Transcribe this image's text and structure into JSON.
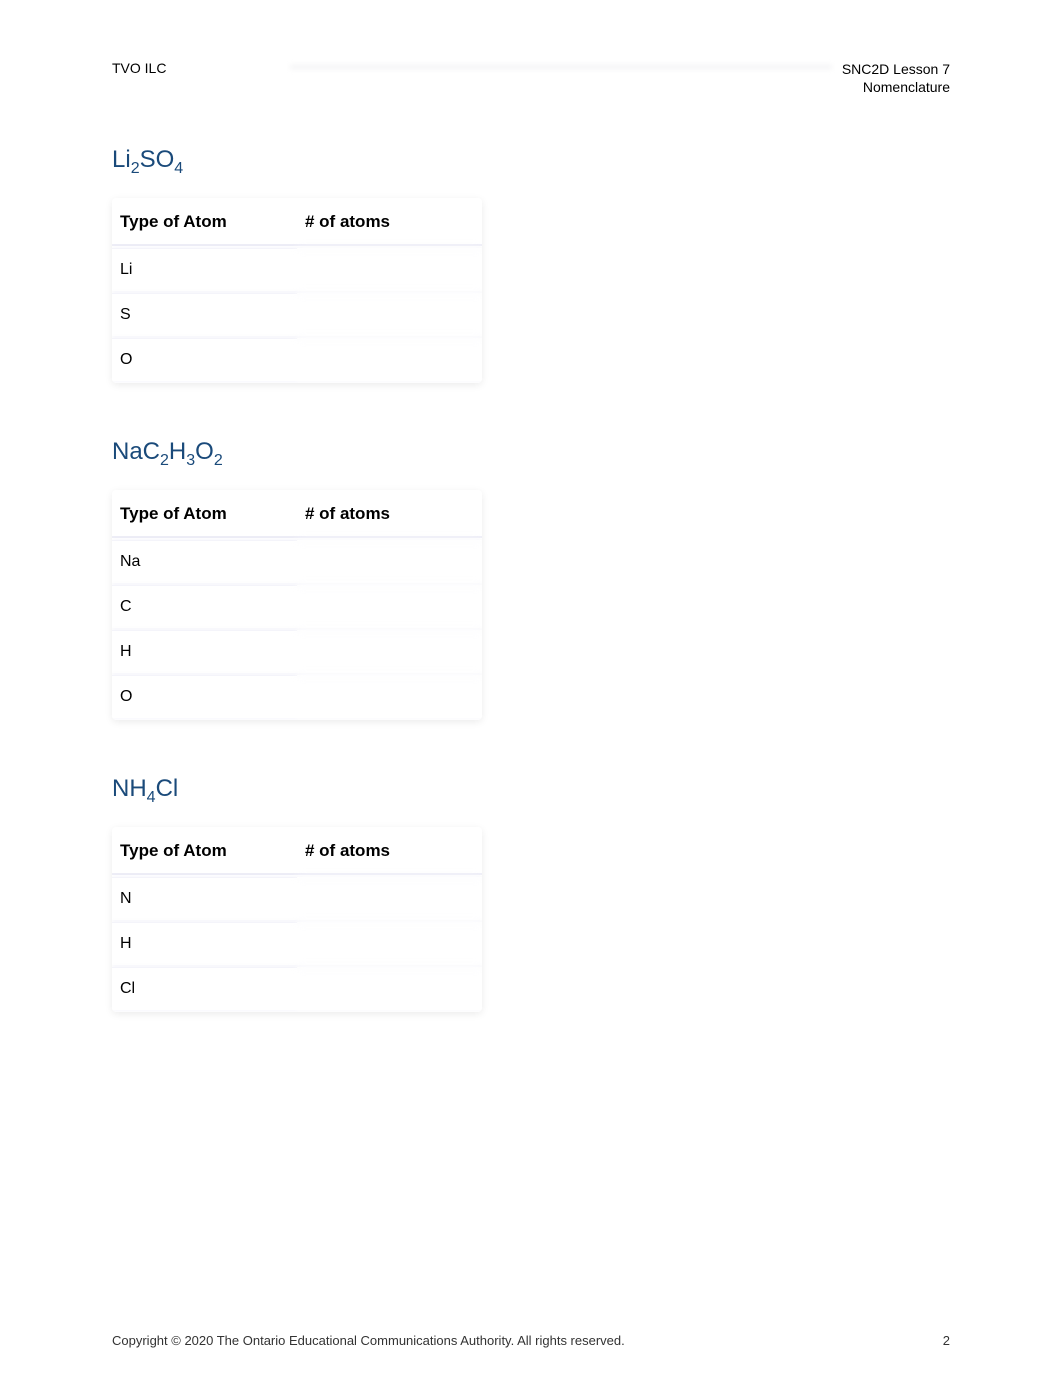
{
  "header": {
    "left": "TVO ILC",
    "right_line1": "SNC2D Lesson 7",
    "right_line2": "Nomenclature"
  },
  "table_headers": {
    "col1": "Type of Atom",
    "col2": "# of atoms"
  },
  "sections": [
    {
      "formula_parts": [
        "Li",
        "2",
        "SO",
        "4"
      ],
      "atoms": [
        "Li",
        "S",
        "O"
      ]
    },
    {
      "formula_parts": [
        "NaC",
        "2",
        "H",
        "3",
        "O",
        "2"
      ],
      "atoms": [
        "Na",
        "C",
        "H",
        "O"
      ]
    },
    {
      "formula_parts": [
        "NH",
        "4",
        "Cl"
      ],
      "atoms": [
        "N",
        "H",
        "Cl"
      ]
    }
  ],
  "footer": {
    "copyright": "Copyright © 2020 The Ontario Educational Communications Authority. All rights reserved.",
    "page_number": "2"
  }
}
